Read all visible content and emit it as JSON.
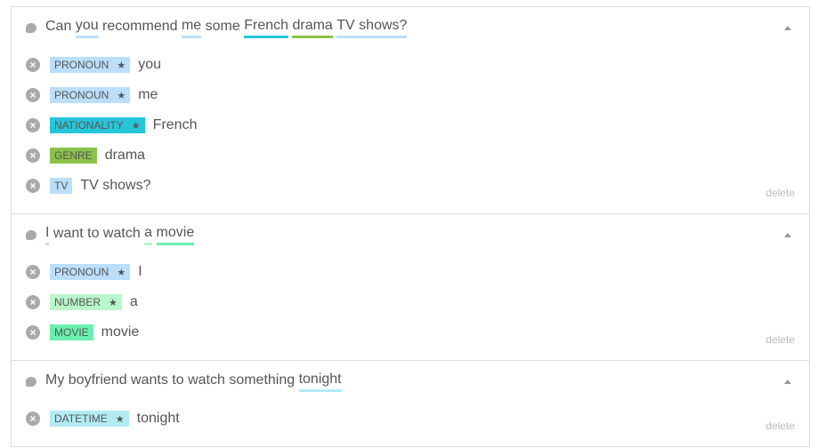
{
  "delete_label": "delete",
  "sections": [
    {
      "segments": [
        {
          "t": "Can "
        },
        {
          "t": "you",
          "c": "#bbdefb"
        },
        {
          "t": " recommend "
        },
        {
          "t": "me",
          "c": "#bbdefb"
        },
        {
          "t": " some "
        },
        {
          "t": "French",
          "c": "#26c6da"
        },
        {
          "t": " "
        },
        {
          "t": "drama",
          "c": "#8bc34a"
        },
        {
          "t": " "
        },
        {
          "t": "TV shows?",
          "c": "#bbdefb"
        }
      ],
      "entities": [
        {
          "label": "PRONOUN",
          "star": true,
          "value": "you",
          "color": "#bbdefb"
        },
        {
          "label": "PRONOUN",
          "star": true,
          "value": "me",
          "color": "#bbdefb"
        },
        {
          "label": "NATIONALITY",
          "star": true,
          "value": "French",
          "color": "#26c6da"
        },
        {
          "label": "GENRE",
          "star": false,
          "value": "drama",
          "color": "#8bc34a"
        },
        {
          "label": "TV",
          "star": false,
          "value": "TV shows?",
          "color": "#bbdefb"
        }
      ]
    },
    {
      "segments": [
        {
          "t": "I",
          "c": "#bbdefb"
        },
        {
          "t": " want to watch "
        },
        {
          "t": "a",
          "c": "#b9f6ca"
        },
        {
          "t": " "
        },
        {
          "t": "movie",
          "c": "#69f0ae"
        }
      ],
      "entities": [
        {
          "label": "PRONOUN",
          "star": true,
          "value": "I",
          "color": "#bbdefb"
        },
        {
          "label": "NUMBER",
          "star": true,
          "value": "a",
          "color": "#b9f6ca"
        },
        {
          "label": "MOVIE",
          "star": false,
          "value": "movie",
          "color": "#69f0ae"
        }
      ]
    },
    {
      "segments": [
        {
          "t": "My boyfriend wants to watch something "
        },
        {
          "t": "tonight",
          "c": "#b2ebf2"
        }
      ],
      "entities": [
        {
          "label": "DATETIME",
          "star": true,
          "value": "tonight",
          "color": "#b2ebf2"
        }
      ]
    }
  ]
}
